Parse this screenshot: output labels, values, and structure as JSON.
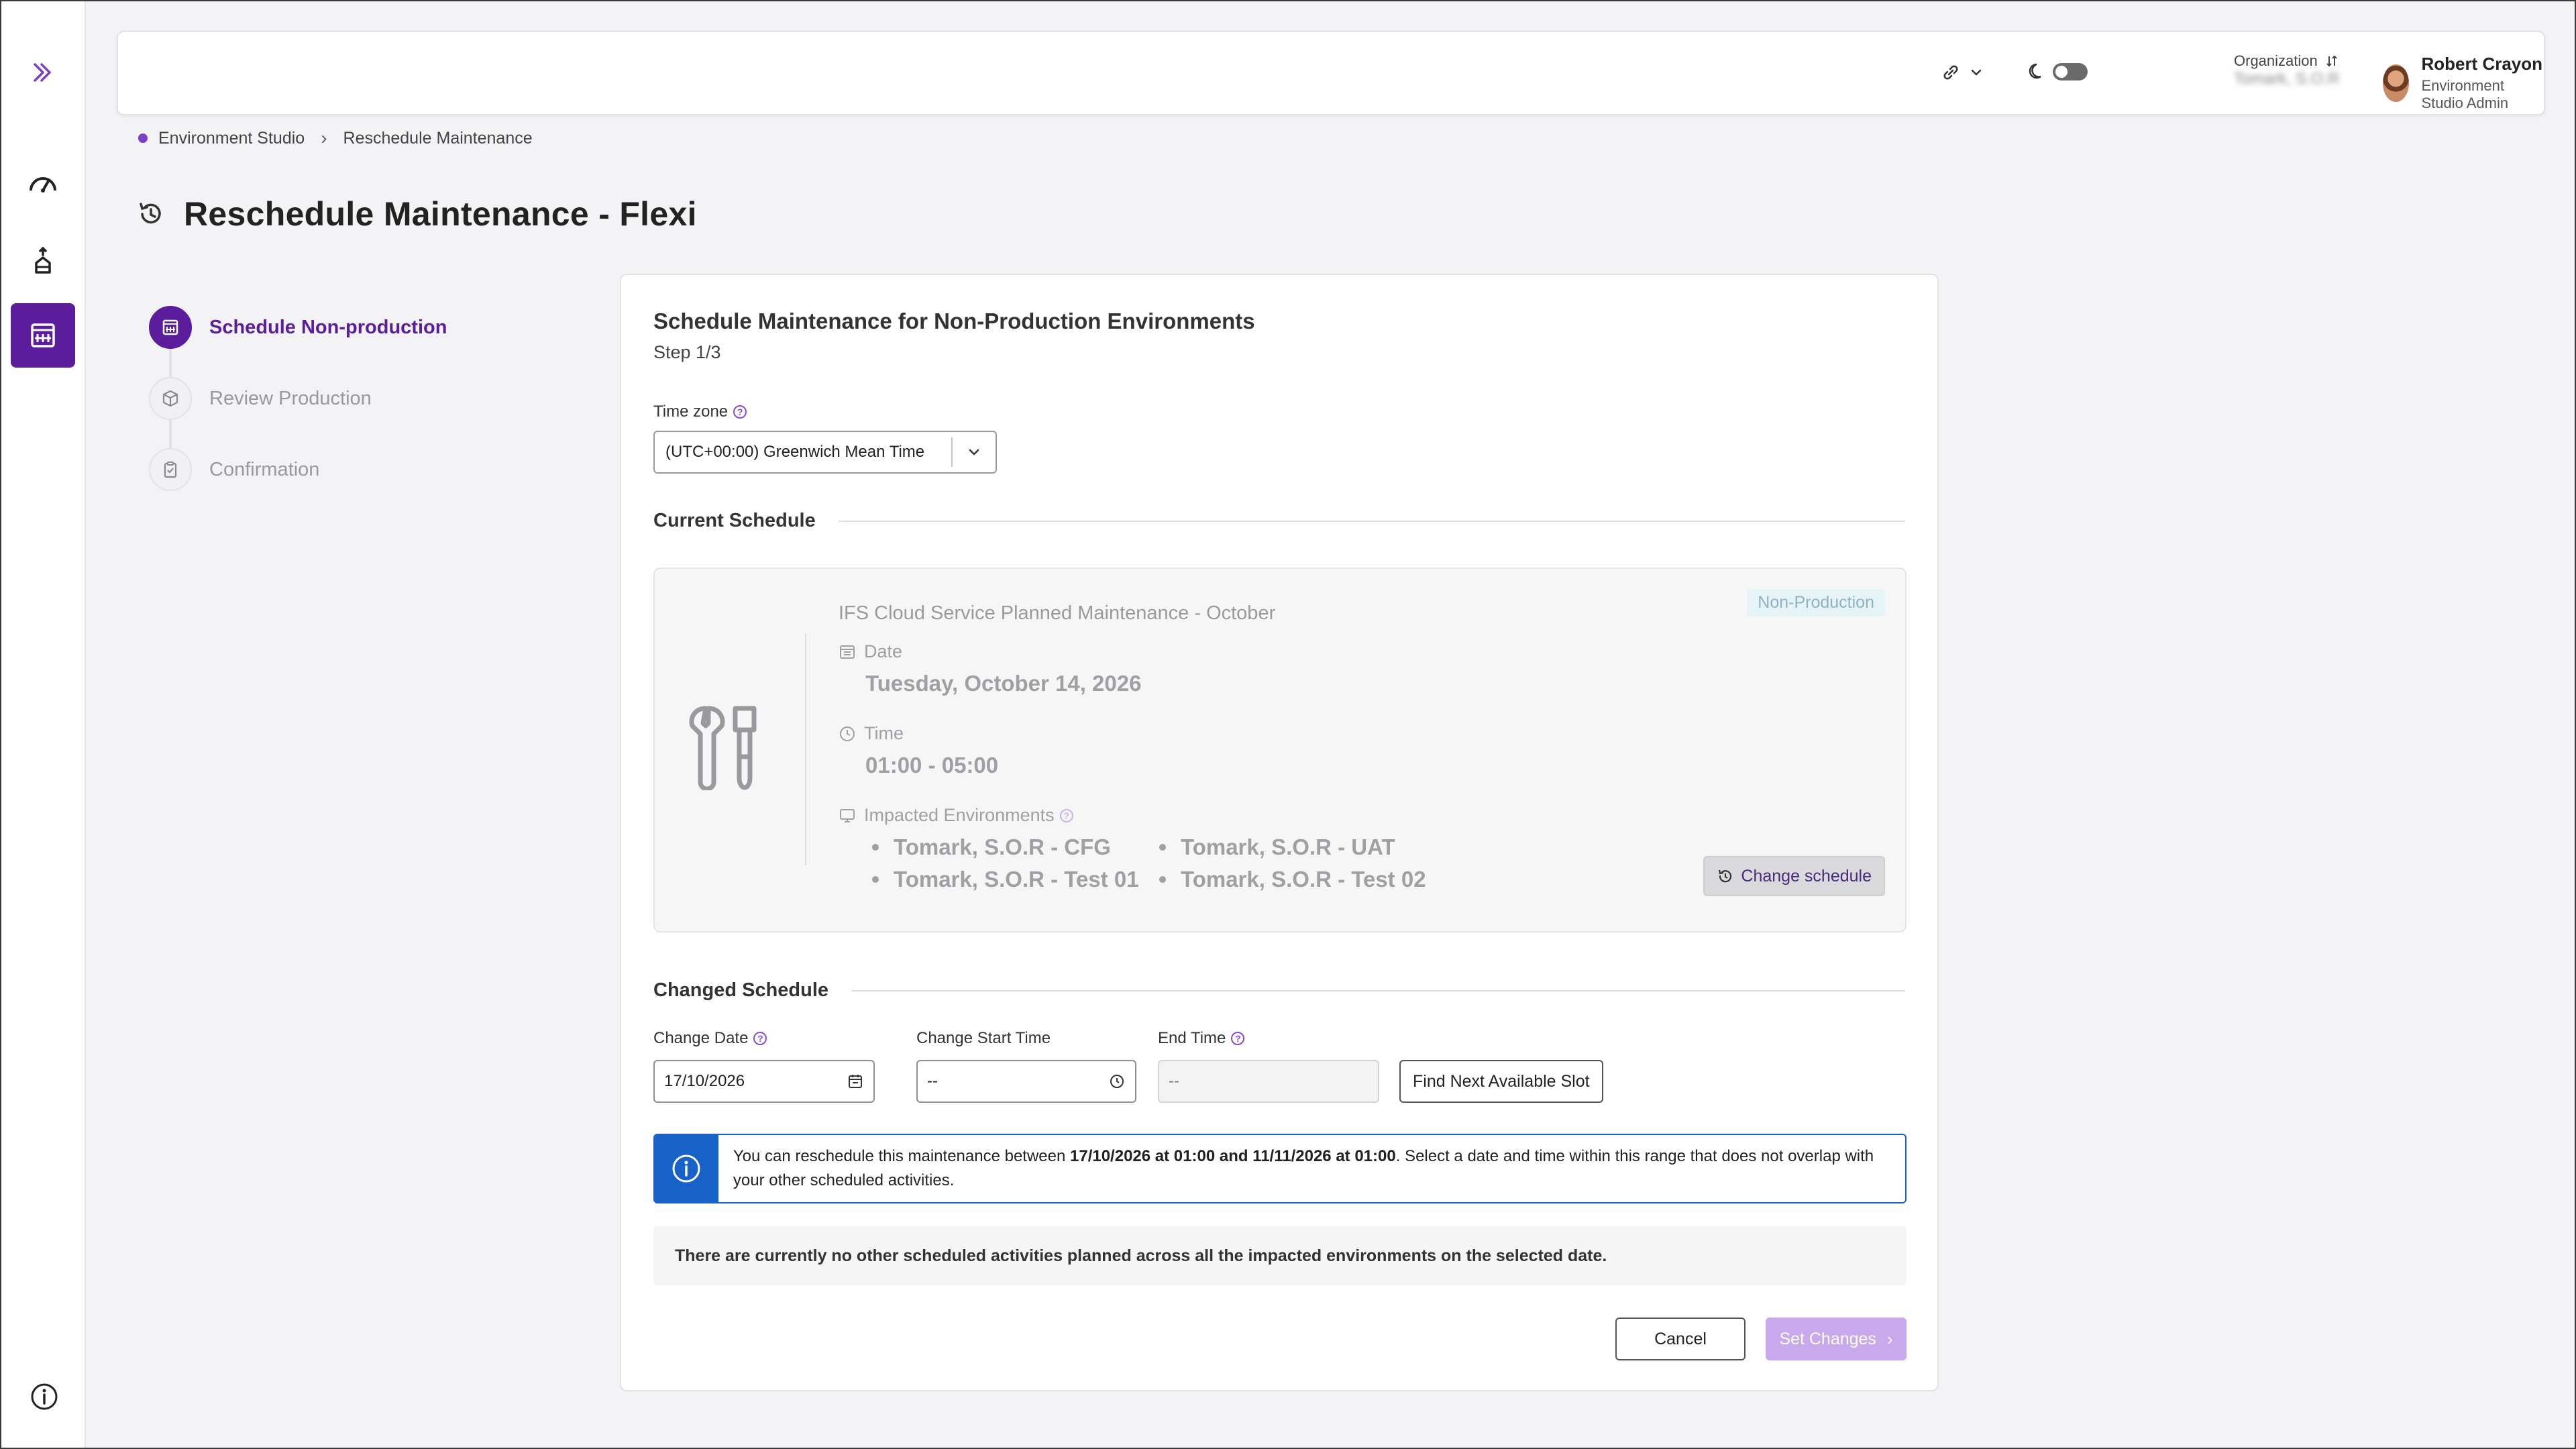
{
  "topbar": {
    "org_label": "Organization",
    "org_value": "Tomark, S.O.R",
    "user_name": "Robert Crayon",
    "user_role": "Environment Studio Admin"
  },
  "breadcrumb": {
    "items": [
      "Environment Studio",
      "Reschedule Maintenance"
    ]
  },
  "page": {
    "title": "Reschedule Maintenance - Flexi"
  },
  "stepper": {
    "steps": [
      {
        "label": "Schedule Non-production",
        "state": "active"
      },
      {
        "label": "Review Production",
        "state": "pending"
      },
      {
        "label": "Confirmation",
        "state": "pending"
      }
    ]
  },
  "card": {
    "title": "Schedule Maintenance for Non-Production Environments",
    "step": "Step 1/3",
    "timezone_label": "Time zone",
    "timezone_value": "(UTC+00:00) Greenwich Mean Time",
    "current_schedule_heading": "Current Schedule",
    "current": {
      "title": "IFS Cloud Service Planned Maintenance - October",
      "badge": "Non-Production",
      "date_label": "Date",
      "date_value": "Tuesday, October 14, 2026",
      "time_label": "Time",
      "time_value": "01:00 - 05:00",
      "envs_label": "Impacted Environments",
      "environments": [
        "Tomark, S.O.R - CFG",
        "Tomark, S.O.R - UAT",
        "Tomark, S.O.R - Test 01",
        "Tomark, S.O.R - Test 02"
      ],
      "change_button": "Change schedule"
    },
    "changed_schedule_heading": "Changed Schedule",
    "change_date_label": "Change Date",
    "change_date_value": "17/10/2026",
    "start_time_label": "Change Start Time",
    "start_time_value": "--",
    "end_time_label": "End Time",
    "end_time_value": "--",
    "find_slot_button": "Find Next Available Slot",
    "info": {
      "prefix": "You can reschedule this maintenance between ",
      "range": "17/10/2026 at 01:00 and 11/11/2026 at 01:00",
      "suffix": ". Select a date and time within this range that does not overlap with your other scheduled activities."
    },
    "note": "There are currently no other scheduled activities planned across all the impacted environments on the selected date.",
    "cancel_button": "Cancel",
    "set_button": "Set Changes"
  },
  "colors": {
    "brand_purple": "#5c1d9c",
    "info_blue": "#1662c9",
    "disabled_purple": "#c9a8ec"
  }
}
